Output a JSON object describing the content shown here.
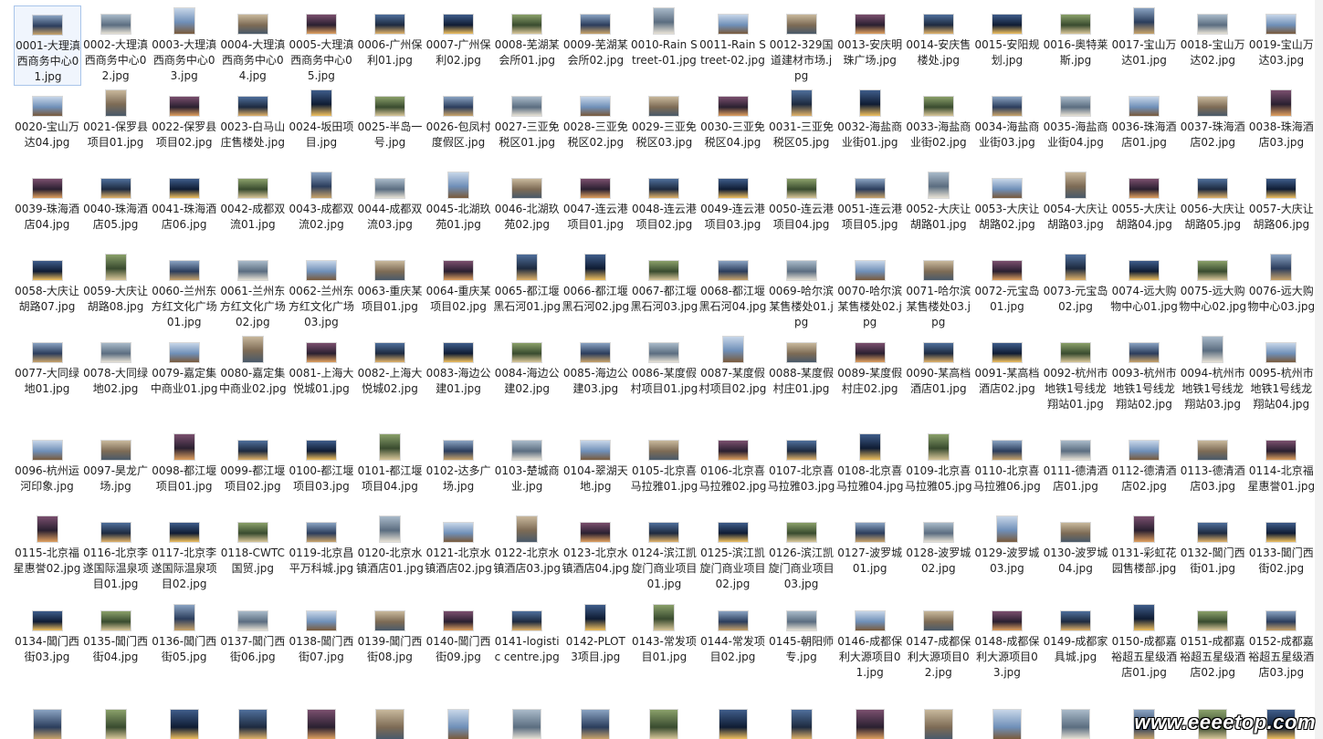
{
  "window": {
    "watermark": "www.eeeetop.com"
  },
  "files": [
    "0001-大理滇西商务中心01.jpg",
    "0002-大理滇西商务中心02.jpg",
    "0003-大理滇西商务中心03.jpg",
    "0004-大理滇西商务中心04.jpg",
    "0005-大理滇西商务中心05.jpg",
    "0006-广州保利01.jpg",
    "0007-广州保利02.jpg",
    "0008-芜湖某会所01.jpg",
    "0009-芜湖某会所02.jpg",
    "0010-Rain Street-01.jpg",
    "0011-Rain Street-02.jpg",
    "0012-329国道建材市场.jpg",
    "0013-安庆明珠广场.jpg",
    "0014-安庆售楼处.jpg",
    "0015-安阳规划.jpg",
    "0016-奥特莱斯.jpg",
    "0017-宝山万达01.jpg",
    "0018-宝山万达02.jpg",
    "0019-宝山万达03.jpg",
    "0020-宝山万达04.jpg",
    "0021-保罗县项目01.jpg",
    "0022-保罗县项目02.jpg",
    "0023-白马山庄售楼处.jpg",
    "0024-坂田项目.jpg",
    "0025-半岛一号.jpg",
    "0026-包凤村度假区.jpg",
    "0027-三亚免税区01.jpg",
    "0028-三亚免税区02.jpg",
    "0029-三亚免税区03.jpg",
    "0030-三亚免税区04.jpg",
    "0031-三亚免税区05.jpg",
    "0032-海盐商业街01.jpg",
    "0033-海盐商业街02.jpg",
    "0034-海盐商业街03.jpg",
    "0035-海盐商业街04.jpg",
    "0036-珠海酒店01.jpg",
    "0037-珠海酒店02.jpg",
    "0038-珠海酒店03.jpg",
    "0039-珠海酒店04.jpg",
    "0040-珠海酒店05.jpg",
    "0041-珠海酒店06.jpg",
    "0042-成都双流01.jpg",
    "0043-成都双流02.jpg",
    "0044-成都双流03.jpg",
    "0045-北湖玖苑01.jpg",
    "0046-北湖玖苑02.jpg",
    "0047-连云港项目01.jpg",
    "0048-连云港项目02.jpg",
    "0049-连云港项目03.jpg",
    "0050-连云港项目04.jpg",
    "0051-连云港项目05.jpg",
    "0052-大庆让胡路01.jpg",
    "0053-大庆让胡路02.jpg",
    "0054-大庆让胡路03.jpg",
    "0055-大庆让胡路04.jpg",
    "0056-大庆让胡路05.jpg",
    "0057-大庆让胡路06.jpg",
    "0058-大庆让胡路07.jpg",
    "0059-大庆让胡路08.jpg",
    "0060-兰州东方红文化广场01.jpg",
    "0061-兰州东方红文化广场02.jpg",
    "0062-兰州东方红文化广场03.jpg",
    "0063-重庆某项目01.jpg",
    "0064-重庆某项目02.jpg",
    "0065-都江堰黑石河01.jpg",
    "0066-都江堰黑石河02.jpg",
    "0067-都江堰黑石河03.jpg",
    "0068-都江堰黑石河04.jpg",
    "0069-哈尔滨某售楼处01.jpg",
    "0070-哈尔滨某售楼处02.jpg",
    "0071-哈尔滨某售楼处03.jpg",
    "0072-元宝岛01.jpg",
    "0073-元宝岛02.jpg",
    "0074-远大购物中心01.jpg",
    "0075-远大购物中心02.jpg",
    "0076-远大购物中心03.jpg",
    "0077-大同绿地01.jpg",
    "0078-大同绿地02.jpg",
    "0079-嘉定集中商业01.jpg",
    "0080-嘉定集中商业02.jpg",
    "0081-上海大悦城01.jpg",
    "0082-上海大悦城02.jpg",
    "0083-海边公建01.jpg",
    "0084-海边公建02.jpg",
    "0085-海边公建03.jpg",
    "0086-某度假村项目01.jpg",
    "0087-某度假村项目02.jpg",
    "0088-某度假村庄01.jpg",
    "0089-某度假村庄02.jpg",
    "0090-某高档酒店01.jpg",
    "0091-某高档酒店02.jpg",
    "0092-杭州市地铁1号线龙翔站01.jpg",
    "0093-杭州市地铁1号线龙翔站02.jpg",
    "0094-杭州市地铁1号线龙翔站03.jpg",
    "0095-杭州市地铁1号线龙翔站04.jpg",
    "0096-杭州运河印象.jpg",
    "0097-昊龙广场.jpg",
    "0098-都江堰项目01.jpg",
    "0099-都江堰项目02.jpg",
    "0100-都江堰项目03.jpg",
    "0101-都江堰项目04.jpg",
    "0102-达多广场.jpg",
    "0103-楚城商业.jpg",
    "0104-翠湖天地.jpg",
    "0105-北京喜马拉雅01.jpg",
    "0106-北京喜马拉雅02.jpg",
    "0107-北京喜马拉雅03.jpg",
    "0108-北京喜马拉雅04.jpg",
    "0109-北京喜马拉雅05.jpg",
    "0110-北京喜马拉雅06.jpg",
    "0111-德清酒店01.jpg",
    "0112-德清酒店02.jpg",
    "0113-德清酒店03.jpg",
    "0114-北京福星惠誉01.jpg",
    "0115-北京福星惠誉02.jpg",
    "0116-北京李遂国际温泉项目01.jpg",
    "0117-北京李遂国际温泉项目02.jpg",
    "0118-CWTC国贸.jpg",
    "0119-北京昌平万科城.jpg",
    "0120-北京水镇酒店01.jpg",
    "0121-北京水镇酒店02.jpg",
    "0122-北京水镇酒店03.jpg",
    "0123-北京水镇酒店04.jpg",
    "0124-滨江凯旋门商业项目01.jpg",
    "0125-滨江凯旋门商业项目02.jpg",
    "0126-滨江凯旋门商业项目03.jpg",
    "0127-波罗城01.jpg",
    "0128-波罗城02.jpg",
    "0129-波罗城03.jpg",
    "0130-波罗城04.jpg",
    "0131-彩虹花园售楼部.jpg",
    "0132-閶门西街01.jpg",
    "0133-閶门西街02.jpg",
    "0134-閶门西街03.jpg",
    "0135-閶门西街04.jpg",
    "0136-閶门西街05.jpg",
    "0137-閶门西街06.jpg",
    "0138-閶门西街07.jpg",
    "0139-閶门西街08.jpg",
    "0140-閶门西街09.jpg",
    "0141-logistic centre.jpg",
    "0142-PLOT 3项目.jpg",
    "0143-常发项目01.jpg",
    "0144-常发项目02.jpg",
    "0145-朝阳师专.jpg",
    "0146-成都保利大源项目01.jpg",
    "0147-成都保利大源项目02.jpg",
    "0148-成都保利大源项目03.jpg",
    "0149-成都家具城.jpg",
    "0150-成都嘉裕超五星级酒店01.jpg",
    "0151-成都嘉裕超五星级酒店02.jpg",
    "0152-成都嘉裕超五星级酒店03.jpg"
  ],
  "icons": [
    "image-thumbnail-icon"
  ]
}
